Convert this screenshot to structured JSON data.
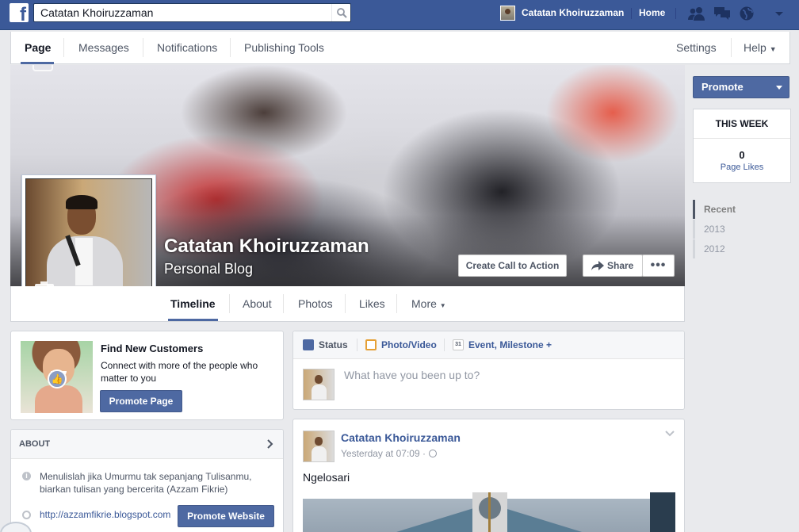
{
  "topbar": {
    "search_value": "Catatan Khoiruzzaman",
    "user_name": "Catatan Khoiruzzaman",
    "home_label": "Home",
    "icons": [
      "friend-requests-icon",
      "messages-icon",
      "notifications-globe-icon",
      "account-menu-icon"
    ]
  },
  "page_nav": {
    "items": [
      "Page",
      "Messages",
      "Notifications",
      "Publishing Tools"
    ],
    "active": "Page",
    "settings_label": "Settings",
    "help_label": "Help"
  },
  "cover": {
    "title": "Catatan Khoiruzzaman",
    "category": "Personal Blog",
    "cta_label": "Create Call to Action",
    "share_label": "Share",
    "more_label": "•••"
  },
  "timeline_tabs": {
    "items": [
      "Timeline",
      "About",
      "Photos",
      "Likes",
      "More"
    ],
    "active": "Timeline"
  },
  "sidebar": {
    "promote_label": "Promote",
    "week_title": "THIS WEEK",
    "page_likes_count": "0",
    "page_likes_label": "Page Likes",
    "years": [
      "Recent",
      "2013",
      "2012"
    ]
  },
  "find_customers": {
    "title": "Find New Customers",
    "description": "Connect with more of the people who matter to you",
    "button_label": "Promote Page"
  },
  "about": {
    "header": "ABOUT",
    "description": "Menulislah jika Umurmu tak sepanjang Tulisanmu, biarkan tulisan yang bercerita (Azzam Fikrie)",
    "url": "http://azzamfikrie.blogspot.com",
    "button_label": "Promote Website"
  },
  "composer": {
    "tabs": [
      "Status",
      "Photo/Video",
      "Event, Milestone +"
    ],
    "calendar_day": "31",
    "placeholder": "What have you been up to?"
  },
  "post": {
    "author": "Catatan Khoiruzzaman",
    "time": "Yesterday at 07:09 ·",
    "text": "Ngelosari"
  },
  "colors": {
    "bluebar": "#3b5998",
    "button_blue": "#4e69a2",
    "link": "#3b5998",
    "background": "#e9eaed"
  }
}
